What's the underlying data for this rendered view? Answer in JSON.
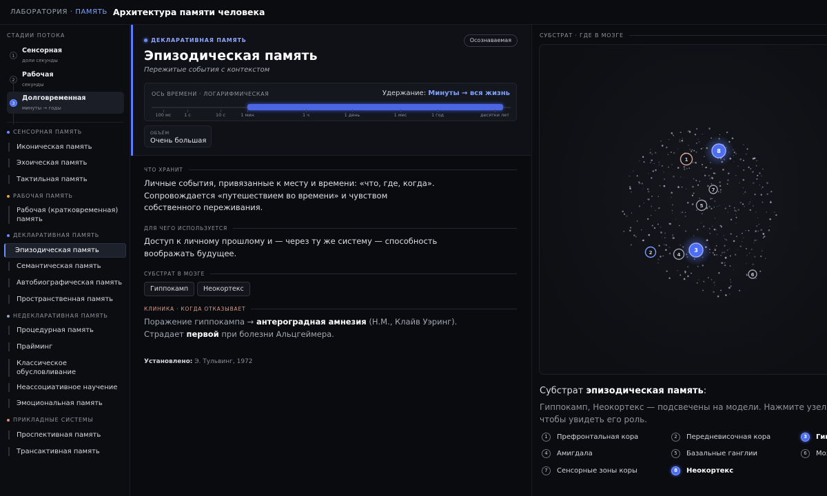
{
  "header": {
    "crumb_lab": "ЛАБОРАТОРИЯ",
    "crumb_sep": "·",
    "crumb_section": "ПАМЯТЬ",
    "title": "Архитектура памяти человека"
  },
  "sidebar": {
    "flow_heading": "СТАДИИ ПОТОКА",
    "stages": [
      {
        "num": "1",
        "title": "Сенсорная",
        "sub": "доли секунды"
      },
      {
        "num": "2",
        "title": "Рабочая",
        "sub": "секунды"
      },
      {
        "num": "3",
        "title": "Долговременная",
        "sub": "минуты → годы"
      }
    ],
    "categories": [
      {
        "label": "СЕНСОРНАЯ ПАМЯТЬ",
        "color": "#6c8bff"
      },
      {
        "label": "РАБОЧАЯ ПАМЯТЬ",
        "color": "#e0a24f"
      },
      {
        "label": "ДЕКЛАРАТИВНАЯ ПАМЯТЬ",
        "color": "#6c8bff"
      },
      {
        "label": "НЕДЕКЛАРАТИВНАЯ ПАМЯТЬ",
        "color": "#9aa3c7"
      },
      {
        "label": "ПРИКЛАДНЫЕ СИСТЕМЫ",
        "color": "#d9907a"
      }
    ],
    "items": [
      "Иконическая память",
      "Эхоическая память",
      "Тактильная память",
      "Рабочая (кратковременная) память",
      "Эпизодическая память",
      "Семантическая память",
      "Автобиографическая память",
      "Пространственная память",
      "Процедурная память",
      "Прайминг",
      "Классическое обусловливание",
      "Неассоциативное научение",
      "Эмоциональная память",
      "Проспективная память",
      "Трансактивная память"
    ]
  },
  "main": {
    "tag": "ДЕКЛАРАТИВНАЯ ПАМЯТЬ",
    "badge": "Осознаваемая",
    "title": "Эпизодическая память",
    "subtitle": "Пережитые события с контекстом",
    "timeline": {
      "label": "ОСЬ ВРЕМЕНИ · ЛОГАРИФМИЧЕСКАЯ",
      "retention_prefix": "Удержание:",
      "retention_value": "Минуты → вся жизнь",
      "ticks": [
        "100 мс",
        "1 с",
        "10 с",
        "1 мин",
        "1 ч",
        "1 день",
        "1 мес",
        "1 год",
        "десятки лет"
      ],
      "range_from": "1 мин",
      "range_to": "десятки лет"
    },
    "volume_label": "ОБЪЁМ",
    "volume_value": "Очень большая",
    "stores_heading": "ЧТО ХРАНИТ",
    "stores_text": "Личные события, привязанные к месту и времени: «что, где, когда». Сопровождается «путешествием во времени» и чувством собственного переживания.",
    "use_heading": "ДЛЯ ЧЕГО ИСПОЛЬЗУЕТСЯ",
    "use_text": "Доступ к личному прошлому и — через ту же систему — способность воображать будущее.",
    "substrate_heading": "СУБСТРАТ В МОЗГЕ",
    "substrate_chips": [
      "Гиппокамп",
      "Неокортекс"
    ],
    "clinic_heading": "КЛИНИКА · КОГДА ОТКАЗЫВАЕТ",
    "clinic_1": "Поражение гиппокампа → ",
    "clinic_2": "антероградная амнезия",
    "clinic_3": " (Н.М., Клайв Уэринг). Страдает ",
    "clinic_4": "первой",
    "clinic_5": " при болезни Альцгеймера.",
    "established_label": "Установлено:",
    "established_value": " Э. Тульвинг, 1972"
  },
  "right": {
    "heading": "СУБСТРАТ · ГДЕ В МОЗГЕ",
    "subst_prefix": "Субстрат ",
    "subst_name": "эпизодическая память",
    "subst_suffix": ":",
    "subst_desc": "Гиппокамп, Неокортекс — подсвечены на модели. Нажмите узел, чтобы увидеть его роль.",
    "nodes": [
      {
        "num": "1",
        "highlight": false
      },
      {
        "num": "2",
        "highlight": false
      },
      {
        "num": "3",
        "highlight": true
      },
      {
        "num": "4",
        "highlight": false
      },
      {
        "num": "5",
        "highlight": false
      },
      {
        "num": "6",
        "highlight": false
      },
      {
        "num": "7",
        "highlight": false
      },
      {
        "num": "8",
        "highlight": true
      }
    ],
    "legend": [
      {
        "num": "1",
        "label": "Префронтальная кора"
      },
      {
        "num": "2",
        "label": "Передневисочная кора"
      },
      {
        "num": "3",
        "label": "Гиппокамп"
      },
      {
        "num": "4",
        "label": "Амигдала"
      },
      {
        "num": "5",
        "label": "Базальные ганглии"
      },
      {
        "num": "6",
        "label": "Мозжечок"
      },
      {
        "num": "7",
        "label": "Сенсорные зоны коры"
      },
      {
        "num": "8",
        "label": "Неокортекс"
      }
    ]
  },
  "colors": {
    "accent": "#6c8bff",
    "accent_fill": "#4a66e0",
    "clinic": "#d99a86"
  }
}
